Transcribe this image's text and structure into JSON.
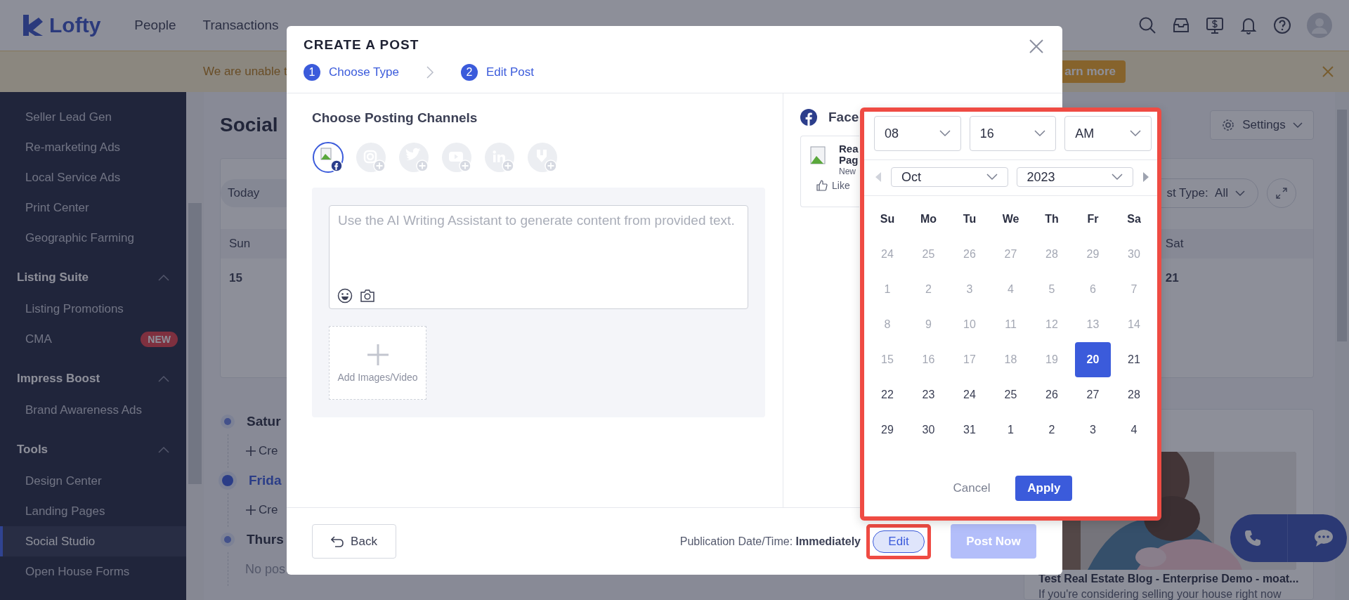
{
  "nav": {
    "logo": "Lofty",
    "items": [
      {
        "label": "People",
        "selected": false
      },
      {
        "label": "Transactions",
        "selected": false
      }
    ]
  },
  "banner": {
    "message": "We are unable t",
    "button": "arn more"
  },
  "sidebar": {
    "sections": [
      {
        "items": [
          {
            "label": "Seller Lead Gen",
            "selected": false
          },
          {
            "label": "Re-marketing Ads",
            "selected": false
          },
          {
            "label": "Local Service Ads",
            "selected": false
          },
          {
            "label": "Print Center",
            "selected": false
          },
          {
            "label": "Geographic Farming",
            "selected": false
          }
        ]
      },
      {
        "title": "Listing Suite",
        "expanded": true,
        "items": [
          {
            "label": "Listing Promotions",
            "selected": false
          },
          {
            "label": "CMA",
            "selected": false,
            "badge": "NEW"
          }
        ]
      },
      {
        "title": "Impress Boost",
        "expanded": true,
        "items": [
          {
            "label": "Brand Awareness Ads",
            "selected": false
          }
        ]
      },
      {
        "title": "Tools",
        "expanded": true,
        "items": [
          {
            "label": "Design Center",
            "selected": false
          },
          {
            "label": "Landing Pages",
            "selected": false
          },
          {
            "label": "Social Studio",
            "selected": true
          },
          {
            "label": "Open House Forms",
            "selected": false
          }
        ]
      }
    ]
  },
  "page": {
    "title": "Social",
    "today_button": "Today",
    "post_type_label": "st Type:",
    "post_type_value": "All",
    "settings_button": "Settings",
    "calendar": {
      "first_day": "Sun",
      "first_date": "15",
      "last_day": "Sat",
      "last_date": "21"
    },
    "timeline": [
      {
        "day": "Satur",
        "current": false,
        "action": "Cre"
      },
      {
        "day": "Frida",
        "current": true,
        "action": "Cre"
      },
      {
        "day": "Thurs",
        "current": false,
        "note": "No pos"
      }
    ],
    "blog_card": {
      "kind": "picture",
      "title": "Test Real Estate Blog - Enterprise Demo - moat...",
      "excerpt": "If you're considering selling your house right now"
    }
  },
  "modal": {
    "title": "CREATE A POST",
    "steps": [
      {
        "number": "1",
        "label": "Choose Type"
      },
      {
        "number": "2",
        "label": "Edit Post"
      }
    ],
    "channels_heading": "Choose Posting Channels",
    "channels": [
      {
        "kind": "facebook",
        "selected": true
      },
      {
        "kind": "instagram",
        "selected": false
      },
      {
        "kind": "twitter",
        "selected": false
      },
      {
        "kind": "youtube",
        "selected": false
      },
      {
        "kind": "linkedin",
        "selected": false
      },
      {
        "kind": "google",
        "selected": false
      }
    ],
    "editor": {
      "placeholder": "Use the AI Writing Assistant to generate content from provided text."
    },
    "add_media": "Add Images/Video",
    "preview": {
      "network": "Face",
      "name_line_1": "Rea",
      "name_line_2": "Pag",
      "meta": "New",
      "like": "Like"
    },
    "footer": {
      "back": "Back",
      "publication_label": "Publication Date/Time:",
      "publication_value": "Immediately",
      "edit": "Edit",
      "edit_highlighted": true,
      "post_now": "Post Now",
      "post_disabled": true
    }
  },
  "date_picker": {
    "highlighted": true,
    "hour": "08",
    "minute": "16",
    "period": "AM",
    "month": "Oct",
    "year": "2023",
    "weekdays": [
      "Su",
      "Mo",
      "Tu",
      "We",
      "Th",
      "Fr",
      "Sa"
    ],
    "weeks": [
      [
        {
          "day": "24",
          "disabled": true,
          "selected": false
        },
        {
          "day": "25",
          "disabled": true,
          "selected": false
        },
        {
          "day": "26",
          "disabled": true,
          "selected": false
        },
        {
          "day": "27",
          "disabled": true,
          "selected": false
        },
        {
          "day": "28",
          "disabled": true,
          "selected": false
        },
        {
          "day": "29",
          "disabled": true,
          "selected": false
        },
        {
          "day": "30",
          "disabled": true,
          "selected": false
        }
      ],
      [
        {
          "day": "1",
          "disabled": true,
          "selected": false
        },
        {
          "day": "2",
          "disabled": true,
          "selected": false
        },
        {
          "day": "3",
          "disabled": true,
          "selected": false
        },
        {
          "day": "4",
          "disabled": true,
          "selected": false
        },
        {
          "day": "5",
          "disabled": true,
          "selected": false
        },
        {
          "day": "6",
          "disabled": true,
          "selected": false
        },
        {
          "day": "7",
          "disabled": true,
          "selected": false
        }
      ],
      [
        {
          "day": "8",
          "disabled": true,
          "selected": false
        },
        {
          "day": "9",
          "disabled": true,
          "selected": false
        },
        {
          "day": "10",
          "disabled": true,
          "selected": false
        },
        {
          "day": "11",
          "disabled": true,
          "selected": false
        },
        {
          "day": "12",
          "disabled": true,
          "selected": false
        },
        {
          "day": "13",
          "disabled": true,
          "selected": false
        },
        {
          "day": "14",
          "disabled": true,
          "selected": false
        }
      ],
      [
        {
          "day": "15",
          "disabled": true,
          "selected": false
        },
        {
          "day": "16",
          "disabled": true,
          "selected": false
        },
        {
          "day": "17",
          "disabled": true,
          "selected": false
        },
        {
          "day": "18",
          "disabled": true,
          "selected": false
        },
        {
          "day": "19",
          "disabled": true,
          "selected": false
        },
        {
          "day": "20",
          "disabled": false,
          "selected": true
        },
        {
          "day": "21",
          "disabled": false,
          "selected": false
        }
      ],
      [
        {
          "day": "22",
          "disabled": false,
          "selected": false
        },
        {
          "day": "23",
          "disabled": false,
          "selected": false
        },
        {
          "day": "24",
          "disabled": false,
          "selected": false
        },
        {
          "day": "25",
          "disabled": false,
          "selected": false
        },
        {
          "day": "26",
          "disabled": false,
          "selected": false
        },
        {
          "day": "27",
          "disabled": false,
          "selected": false
        },
        {
          "day": "28",
          "disabled": false,
          "selected": false
        }
      ],
      [
        {
          "day": "29",
          "disabled": false,
          "selected": false
        },
        {
          "day": "30",
          "disabled": false,
          "selected": false
        },
        {
          "day": "31",
          "disabled": false,
          "selected": false
        },
        {
          "day": "1",
          "disabled": false,
          "selected": false
        },
        {
          "day": "2",
          "disabled": false,
          "selected": false
        },
        {
          "day": "3",
          "disabled": false,
          "selected": false
        },
        {
          "day": "4",
          "disabled": false,
          "selected": false
        }
      ]
    ],
    "cancel": "Cancel",
    "apply": "Apply"
  }
}
